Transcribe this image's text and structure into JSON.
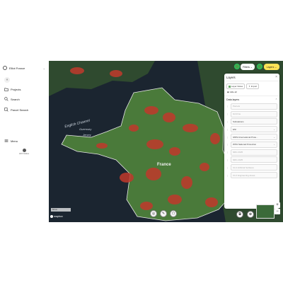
{
  "sidebar": {
    "org_name": "Elliot France",
    "collapse_glyph": "«",
    "items": [
      {
        "label": "Projects",
        "icon": "folder-icon"
      },
      {
        "label": "Search",
        "icon": "search-icon"
      },
      {
        "label": "Parcel Search",
        "icon": "parcel-search-icon"
      }
    ],
    "menu_label": "Menu",
    "user_label": "Hirth Stokes"
  },
  "map": {
    "labels": {
      "channel": "English Channel",
      "guernsey": "Guernsey",
      "jersey": "Jersey",
      "country": "France"
    },
    "attribution": "mapbox",
    "scale_text": "50 km",
    "accent": "#ffe457",
    "heat_color": "#c0392b"
  },
  "controls": {
    "filters_label": "Filters",
    "layers_label": "Layers",
    "zoom_in": "+",
    "zoom_out": "−"
  },
  "layers_panel": {
    "title": "Layers",
    "close_glyph": "×",
    "buttons": [
      {
        "label": "Layer Notes"
      },
      {
        "label": "Import"
      }
    ],
    "hide_all": "Hide all",
    "section_title": "Data layers",
    "section_glyph": "⌃",
    "rows": [
      {
        "label": "Parcels",
        "dim": true
      },
      {
        "label": "Grid line",
        "dim": true
      },
      {
        "label": "Substations",
        "dim": false
      },
      {
        "label": "ENI",
        "dim": false,
        "chev": true
      },
      {
        "label": "IWPH International Prote...",
        "dim": false,
        "chev": true
      },
      {
        "label": "WPH National Protection",
        "dim": false,
        "chev": true
      },
      {
        "label": "NRG 2025",
        "dim": true
      },
      {
        "label": "NRG 2025",
        "dim": true
      },
      {
        "label": "CLC Artificial Surfaces",
        "dim": true
      },
      {
        "label": "CLC Engineering Areas",
        "dim": true
      }
    ]
  }
}
